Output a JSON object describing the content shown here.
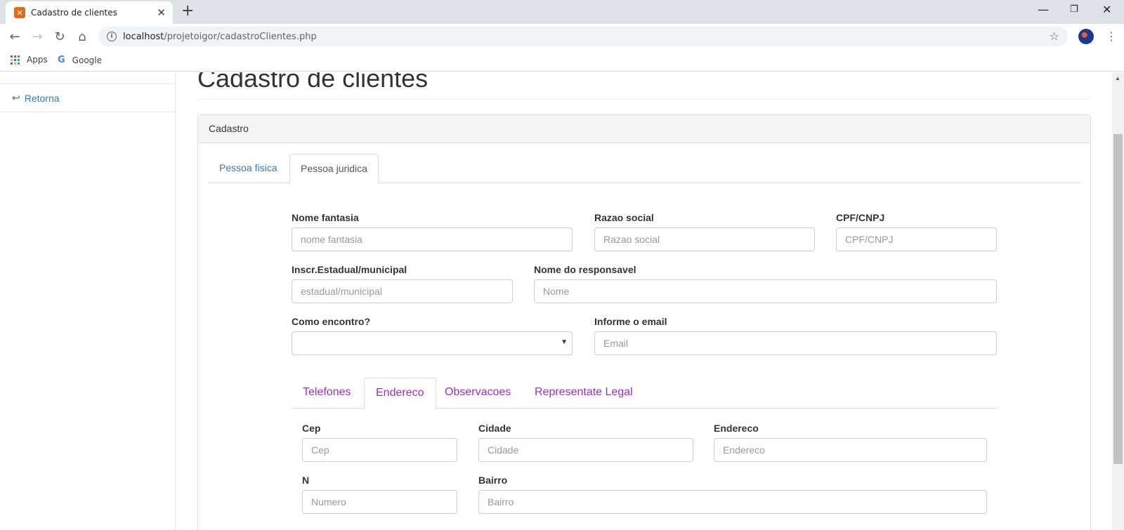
{
  "browser": {
    "tab_title": "Cadastro de clientes",
    "url_host": "localhost",
    "url_path": "/projetoigor/cadastroClientes.php",
    "bookmarks": [
      "Apps",
      "Google"
    ]
  },
  "sidebar": {
    "link_label": "Retorna"
  },
  "page": {
    "title": "Cadastro de clientes",
    "panel_heading": "Cadastro",
    "tabs": [
      "Pessoa fisica",
      "Pessoa juridica"
    ],
    "active_tab": "Pessoa juridica"
  },
  "form": {
    "nome_fantasia": {
      "label": "Nome fantasia",
      "placeholder": "nome fantasia"
    },
    "razao_social": {
      "label": "Razao social",
      "placeholder": "Razao social"
    },
    "cpf_cnpj": {
      "label": "CPF/CNPJ",
      "placeholder": "CPF/CNPJ"
    },
    "inscr": {
      "label": "Inscr.Estadual/municipal",
      "placeholder": "estadual/municipal"
    },
    "responsavel": {
      "label": "Nome do responsavel",
      "placeholder": "Nome"
    },
    "como_encontrou": {
      "label": "Como encontro?",
      "value": ""
    },
    "email": {
      "label": "Informe o email",
      "placeholder": "Email"
    }
  },
  "subtabs": {
    "items": [
      "Telefones",
      "Endereco",
      "Observacoes",
      "Representate Legal"
    ],
    "active": "Endereco"
  },
  "endereco": {
    "cep": {
      "label": "Cep",
      "placeholder": "Cep"
    },
    "cidade": {
      "label": "Cidade",
      "placeholder": "Cidade"
    },
    "endereco": {
      "label": "Endereco",
      "placeholder": "Endereco"
    },
    "numero": {
      "label": "N",
      "placeholder": "Numero"
    },
    "bairro": {
      "label": "Bairro",
      "placeholder": "Bairro"
    }
  },
  "colors": {
    "link_blue": "#337ab7",
    "subtab_purple": "#9b30c8",
    "favicon_orange": "#e06c1b"
  }
}
